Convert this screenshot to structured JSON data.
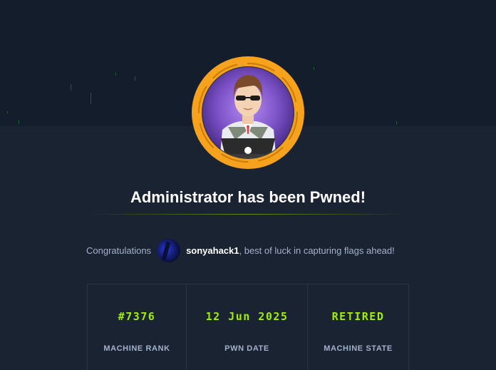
{
  "machine": {
    "name": "Administrator",
    "pwned_title": "Administrator has been Pwned!"
  },
  "congrats": {
    "prefix": "Congratulations",
    "username": "sonyahack1",
    "suffix": ", best of luck in capturing flags ahead!"
  },
  "stats": [
    {
      "value": "#7376",
      "label": "MACHINE RANK"
    },
    {
      "value": "12 Jun 2025",
      "label": "PWN DATE"
    },
    {
      "value": "RETIRED",
      "label": "MACHINE STATE"
    }
  ],
  "colors": {
    "accent_green": "#9fef00",
    "ring_orange": "#f6a21c",
    "background": "#1a2332",
    "muted_text": "#a4b1cd"
  },
  "icons": {
    "machine_avatar": "administrator-avatar-icon",
    "user_avatar": "user-avatar-icon"
  }
}
